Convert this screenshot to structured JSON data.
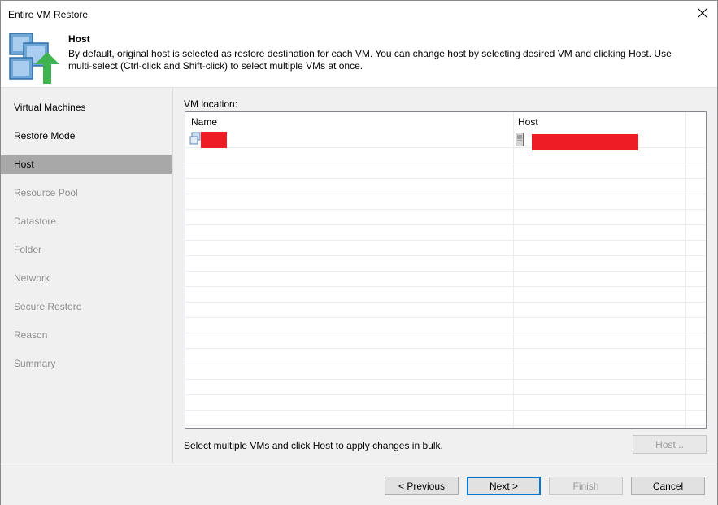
{
  "window": {
    "title": "Entire VM Restore"
  },
  "header": {
    "title": "Host",
    "description": "By default, original host is selected as restore destination for each VM. You can change host by selecting desired VM and clicking Host. Use multi-select (Ctrl-click and Shift-click) to select multiple VMs at once."
  },
  "sidebar": {
    "items": [
      {
        "label": "Virtual Machines",
        "state": "enabled"
      },
      {
        "label": "Restore Mode",
        "state": "enabled"
      },
      {
        "label": "Host",
        "state": "selected"
      },
      {
        "label": "Resource Pool",
        "state": "disabled"
      },
      {
        "label": "Datastore",
        "state": "disabled"
      },
      {
        "label": "Folder",
        "state": "disabled"
      },
      {
        "label": "Network",
        "state": "disabled"
      },
      {
        "label": "Secure Restore",
        "state": "disabled"
      },
      {
        "label": "Reason",
        "state": "disabled"
      },
      {
        "label": "Summary",
        "state": "disabled"
      }
    ]
  },
  "main": {
    "section_label": "VM location:",
    "columns": [
      "Name",
      "Host"
    ],
    "hint": "Select multiple VMs and click Host to apply changes in bulk.",
    "host_button": "Host..."
  },
  "footer": {
    "previous": "< Previous",
    "next": "Next >",
    "finish": "Finish",
    "cancel": "Cancel"
  },
  "colors": {
    "selected_nav": "#a8a8a8",
    "panel_bg": "#f0f0f0",
    "redaction": "#ee1c25",
    "accent_arrow": "#3fb34f",
    "default_button_border": "#0078d7"
  },
  "icons": [
    "close-icon",
    "vm-restore-icon",
    "vm-icon",
    "host-server-icon"
  ]
}
